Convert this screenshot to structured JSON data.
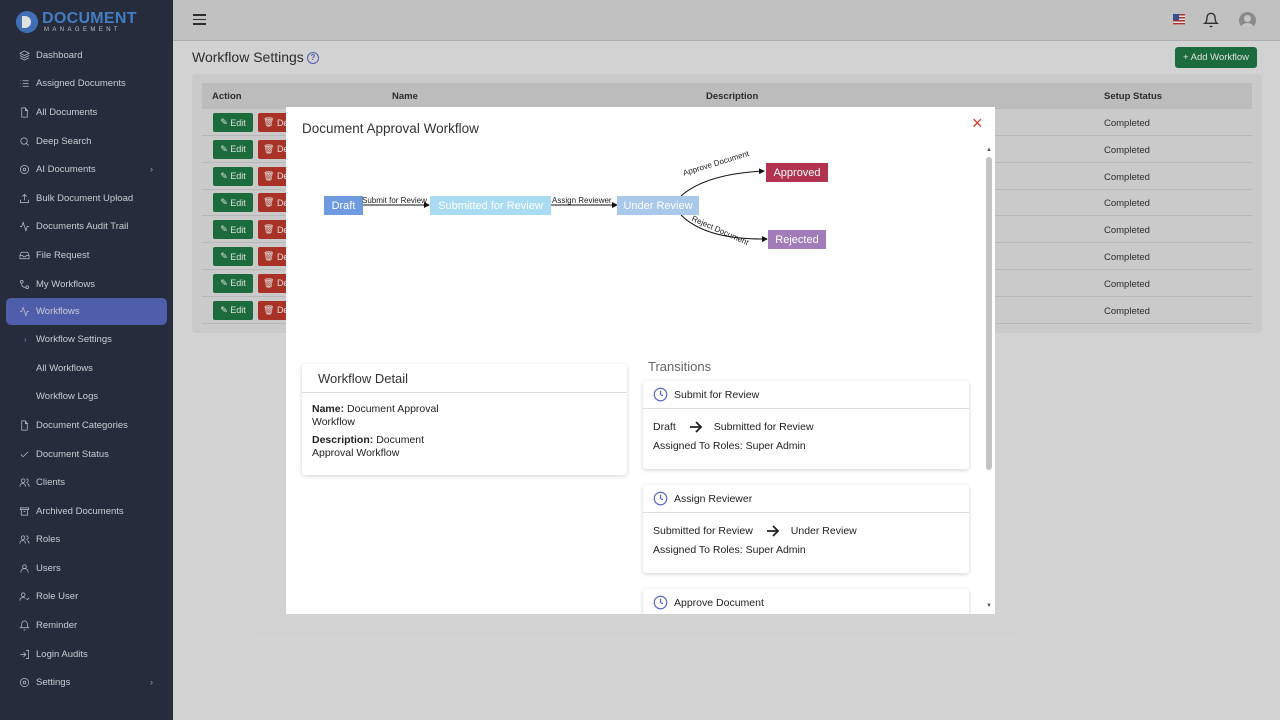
{
  "brand": {
    "title": "DOCUMENT",
    "subtitle": "MANAGEMENT"
  },
  "sidebar": {
    "items": [
      {
        "label": "Dashboard",
        "icon": "layers-icon"
      },
      {
        "label": "Assigned Documents",
        "icon": "list-icon"
      },
      {
        "label": "All Documents",
        "icon": "file-icon"
      },
      {
        "label": "Deep Search",
        "icon": "search-icon"
      },
      {
        "label": "AI Documents",
        "icon": "gear-icon",
        "caret": "›"
      },
      {
        "label": "Bulk Document Upload",
        "icon": "upload-icon"
      },
      {
        "label": "Documents Audit Trail",
        "icon": "activity-icon"
      },
      {
        "label": "File Request",
        "icon": "inbox-icon"
      },
      {
        "label": "My Workflows",
        "icon": "flow-icon"
      },
      {
        "label": "Workflows",
        "icon": "activity-icon",
        "active": true
      }
    ],
    "subitems": [
      "Workflow Settings",
      "All Workflows",
      "Workflow Logs"
    ],
    "items2": [
      {
        "label": "Document Categories",
        "icon": "file-icon"
      },
      {
        "label": "Document Status",
        "icon": "check-icon"
      },
      {
        "label": "Clients",
        "icon": "users-icon"
      },
      {
        "label": "Archived Documents",
        "icon": "archive-icon"
      },
      {
        "label": "Roles",
        "icon": "users-icon"
      },
      {
        "label": "Users",
        "icon": "user-icon"
      },
      {
        "label": "Role User",
        "icon": "user-check-icon"
      },
      {
        "label": "Reminder",
        "icon": "bell-icon"
      },
      {
        "label": "Login Audits",
        "icon": "login-icon"
      },
      {
        "label": "Settings",
        "icon": "gear-icon",
        "caret": "›"
      }
    ]
  },
  "page": {
    "title": "Workflow Settings",
    "help": "?",
    "add_button": "+ Add Workflow",
    "columns": [
      "Action",
      "Name",
      "Description",
      "Setup Status"
    ],
    "edit_label": "Edit",
    "delete_label": "De",
    "rows": [
      "Completed",
      "Completed",
      "Completed",
      "Completed",
      "Completed",
      "Completed",
      "Completed",
      "Completed"
    ]
  },
  "modal": {
    "title": "Document Approval Workflow",
    "close": "×",
    "diagram": {
      "nodes": {
        "draft": "Draft",
        "submitted": "Submitted for Review",
        "under_review": "Under Review",
        "approved": "Approved",
        "rejected": "Rejected"
      },
      "edges": {
        "submit": "Submit for Review",
        "assign": "Assign Reviewer",
        "approve": "Approve Document",
        "reject": "Reject Document"
      },
      "colors": {
        "draft": "#6e9ae0",
        "submitted": "#a9dcf2",
        "under_review": "#a9c8ea",
        "approved": "#b2334f",
        "rejected": "#a17cb8"
      }
    },
    "detail": {
      "title": "Workflow Detail",
      "name_label": "Name:",
      "name_value": "Document Approval Workflow",
      "desc_label": "Description:",
      "desc_value": "Document Approval Workflow"
    },
    "transitions_title": "Transitions",
    "transitions": [
      {
        "name": "Submit for Review",
        "from": "Draft",
        "to": "Submitted for Review",
        "roles": "Assigned To Roles: Super Admin"
      },
      {
        "name": "Assign Reviewer",
        "from": "Submitted for Review",
        "to": "Under Review",
        "roles": "Assigned To Roles: Super Admin"
      },
      {
        "name": "Approve Document",
        "from": "",
        "to": "",
        "roles": ""
      }
    ]
  }
}
